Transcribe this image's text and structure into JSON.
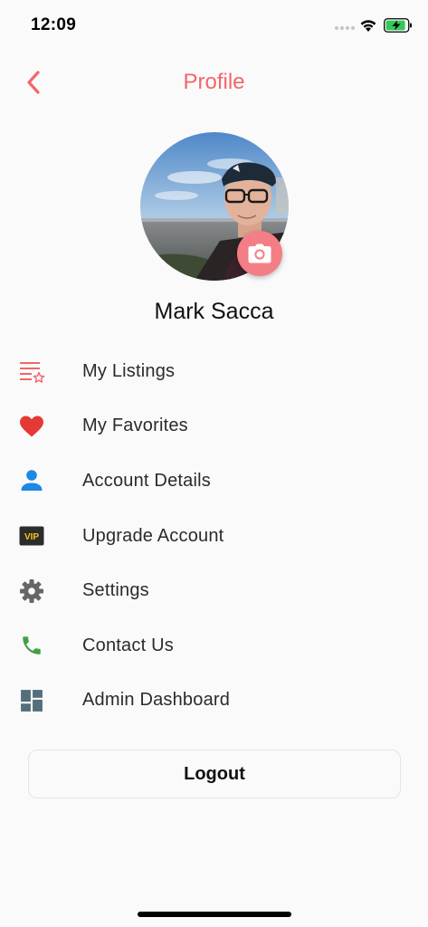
{
  "status_bar": {
    "time": "12:09",
    "icons": [
      "signal-icon",
      "wifi-icon",
      "battery-charging-icon"
    ]
  },
  "header": {
    "title": "Profile",
    "back_icon": "chevron-left-icon"
  },
  "profile": {
    "name": "Mark Sacca",
    "camera_icon": "camera-icon"
  },
  "menu": {
    "items": [
      {
        "label": "My Listings",
        "icon": "listings-star-icon",
        "color": "#f2666a"
      },
      {
        "label": "My Favorites",
        "icon": "heart-icon",
        "color": "#e53935"
      },
      {
        "label": "Account Details",
        "icon": "person-icon",
        "color": "#1e88e5"
      },
      {
        "label": "Upgrade Account",
        "icon": "vip-icon",
        "color": "#f5c518"
      },
      {
        "label": "Settings",
        "icon": "gear-icon",
        "color": "#666666"
      },
      {
        "label": "Contact Us",
        "icon": "phone-icon",
        "color": "#43a047"
      },
      {
        "label": "Admin Dashboard",
        "icon": "dashboard-icon",
        "color": "#546e7a"
      }
    ]
  },
  "logout": {
    "label": "Logout"
  },
  "colors": {
    "accent": "#f2666a",
    "camera_button": "#f47e85",
    "background": "#fafafa"
  }
}
